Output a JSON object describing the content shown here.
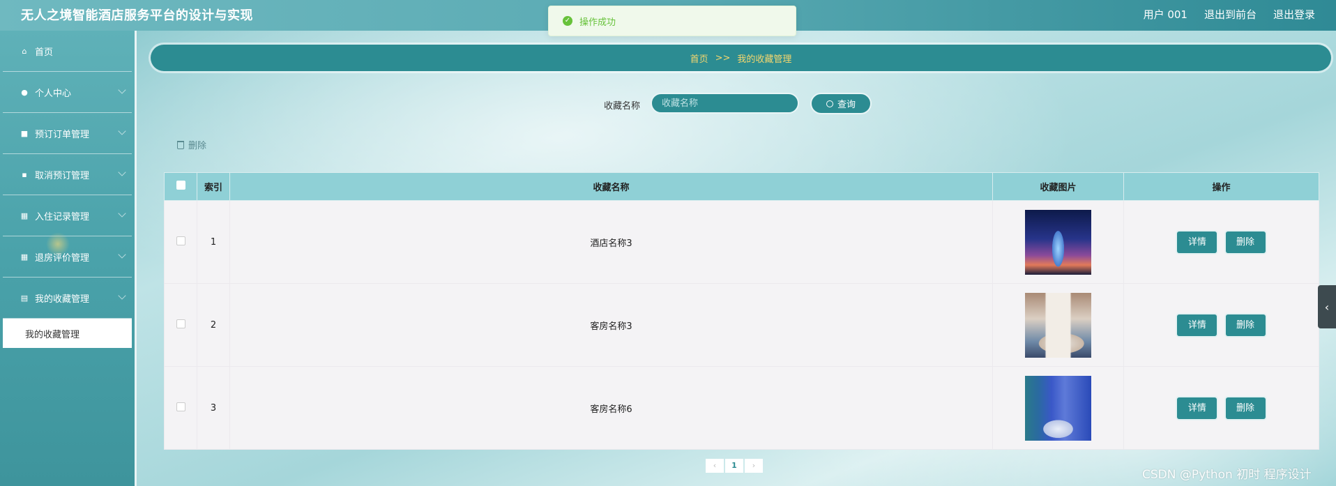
{
  "header": {
    "app_title": "无人之境智能酒店服务平台的设计与实现",
    "user_label": "用户 001",
    "to_front_label": "退出到前台",
    "logout_label": "退出登录"
  },
  "toast": {
    "message": "操作成功"
  },
  "sidebar": {
    "items": [
      {
        "label": "首页",
        "icon": "home-icon"
      },
      {
        "label": "个人中心",
        "icon": "user-icon"
      },
      {
        "label": "预订订单管理",
        "icon": "briefcase-icon"
      },
      {
        "label": "取消预订管理",
        "icon": "comment-icon"
      },
      {
        "label": "入住记录管理",
        "icon": "grid-icon"
      },
      {
        "label": "退房评价管理",
        "icon": "grid-icon"
      },
      {
        "label": "我的收藏管理",
        "icon": "clipboard-icon"
      }
    ],
    "submenu": {
      "label": "我的收藏管理"
    }
  },
  "breadcrumb": {
    "home": "首页",
    "separator": ">>",
    "current": "我的收藏管理"
  },
  "search": {
    "label": "收藏名称",
    "placeholder": "收藏名称",
    "button_label": "查询"
  },
  "toolbar": {
    "delete_label": "删除"
  },
  "table": {
    "headers": {
      "index": "索引",
      "name": "收藏名称",
      "image": "收藏图片",
      "actions": "操作"
    },
    "rows": [
      {
        "index": "1",
        "name": "酒店名称3",
        "image": "hotel-tower-night-photo"
      },
      {
        "index": "2",
        "name": "客房名称3",
        "image": "guest-room-photo"
      },
      {
        "index": "3",
        "name": "客房名称6",
        "image": "blue-guest-room-photo"
      }
    ],
    "detail_label": "详情",
    "delete_label": "删除"
  },
  "pagination": {
    "prev": "‹",
    "current_page": "1",
    "next": "›"
  },
  "watermark": "CSDN @Python 初时 程序设计",
  "colors": {
    "primary": "#2c8c92",
    "header_row": "#8fd0d6",
    "breadcrumb_text": "#f5d76e",
    "toast_success": "#67c23a"
  }
}
